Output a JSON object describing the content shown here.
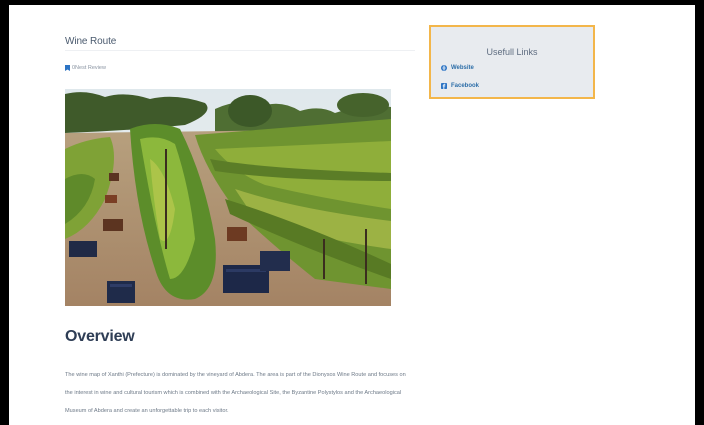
{
  "page": {
    "title": "Wine Route",
    "reviews_label": "0Nest Review",
    "photo_alt": "Vineyard",
    "overview": {
      "heading": "Overview",
      "text": "The wine map of Xanthi (Prefecture) is dominated by the vineyard of Abdera. The area is part of the Dionysos Wine Route and focuses on the interest in wine and cultural tourism which is combined with the Archaeological Site, the Byzantine Polystylos and the Archaeological Museum of Abdera and create an unforgettable trip to each visitor."
    }
  },
  "sidebar": {
    "title": "Usefull Links",
    "links": [
      {
        "label": "Website",
        "icon": "globe-icon"
      },
      {
        "label": "Facebook",
        "icon": "facebook-icon"
      }
    ]
  },
  "colors": {
    "accent_border": "#f3b64a",
    "link": "#2d6ea8",
    "heading": "#2e3d55",
    "panel_bg": "#e8ebef",
    "frame": "#000000"
  }
}
